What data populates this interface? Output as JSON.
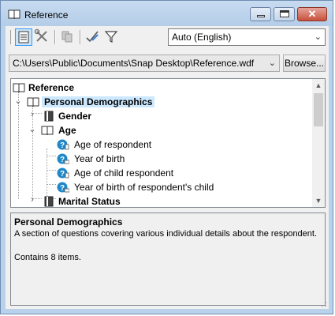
{
  "window": {
    "title": "Reference",
    "title_icon": "book-icon",
    "controls": {
      "minimize": "minimize-icon",
      "maximize": "maximize-icon",
      "close": "close-icon"
    }
  },
  "toolbar": {
    "tools": [
      {
        "name": "view-details-tool",
        "icon": "document-icon",
        "active": true
      },
      {
        "name": "tools-tool",
        "icon": "wrench-screwdriver-icon",
        "active": false
      },
      {
        "name": "copy-tool",
        "icon": "copy-icon",
        "active": false
      },
      {
        "name": "check-tool",
        "icon": "checkmark-pen-icon",
        "active": false
      },
      {
        "name": "filter-tool",
        "icon": "filter-icon",
        "active": false
      }
    ],
    "language": {
      "selected": "Auto (English)"
    }
  },
  "path": {
    "value": "C:\\Users\\Public\\Documents\\Snap Desktop\\Reference.wdf",
    "browse_label": "Browse..."
  },
  "tree": {
    "items": [
      {
        "label": "Reference",
        "icon": "book-icon",
        "bold": true,
        "expander": ""
      },
      {
        "label": "Personal Demographics",
        "icon": "open-book-icon",
        "bold": true,
        "expander": "expanded",
        "selected": true
      },
      {
        "label": "Gender",
        "icon": "section-book-icon",
        "bold": true,
        "expander": "collapsed"
      },
      {
        "label": "Age",
        "icon": "open-book-icon",
        "bold": true,
        "expander": "expanded"
      },
      {
        "label": "Age of respondent",
        "icon": "question-icon",
        "bold": false,
        "expander": ""
      },
      {
        "label": "Year of birth",
        "icon": "question-icon",
        "bold": false,
        "expander": ""
      },
      {
        "label": "Age of child respondent",
        "icon": "question-icon",
        "bold": false,
        "expander": ""
      },
      {
        "label": "Year of birth of respondent's child",
        "icon": "question-icon",
        "bold": false,
        "expander": ""
      },
      {
        "label": "Marital Status",
        "icon": "section-book-icon",
        "bold": true,
        "expander": "collapsed"
      }
    ]
  },
  "description": {
    "title": "Personal Demographics",
    "body": "A section of questions covering various individual details about the respondent.",
    "count": "Contains 8 items."
  },
  "colors": {
    "titlebar": "#b9d1ea",
    "selection": "#cce8ff",
    "question_icon": "#1e88c8",
    "close_button": "#c7503c"
  }
}
